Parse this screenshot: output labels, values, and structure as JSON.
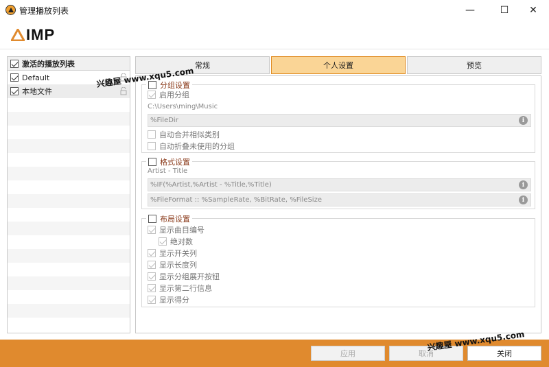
{
  "window": {
    "title": "管理播放列表",
    "min": "—",
    "max": "☐",
    "close": "✕"
  },
  "logo": {
    "text": "IMP"
  },
  "left_panel": {
    "header": "激活的播放列表",
    "items": [
      {
        "label": "Default"
      },
      {
        "label": "本地文件"
      }
    ]
  },
  "tabs": [
    {
      "label": "常规"
    },
    {
      "label": "个人设置"
    },
    {
      "label": "预览"
    }
  ],
  "grouping": {
    "title": "分组设置",
    "enable_label": "启用分组",
    "path_hint": "C:\\Users\\ming\\Music",
    "template": "%FileDir",
    "auto_merge_label": "自动合并相似类别",
    "auto_collapse_label": "自动折叠未使用的分组"
  },
  "format": {
    "title": "格式设置",
    "hint": "Artist - Title",
    "line1": "%IF(%Artist,%Artist - %Title,%Title)",
    "line2": "%FileFormat :: %SampleRate, %BitRate, %FileSize"
  },
  "layout": {
    "title": "布局设置",
    "options": [
      {
        "label": "显示曲目编号"
      },
      {
        "label": "绝对数"
      },
      {
        "label": "显示开关列"
      },
      {
        "label": "显示长度列"
      },
      {
        "label": "显示分组展开按钮"
      },
      {
        "label": "显示第二行信息"
      },
      {
        "label": "显示得分"
      }
    ]
  },
  "footer": {
    "apply": "应用",
    "cancel": "取消",
    "close": "关闭"
  },
  "watermarks": [
    "兴趣屋 www.xqu5.com",
    "兴趣屋 www.xqu5.com"
  ],
  "colors": {
    "accent": "#e08a2e",
    "tab_active": "#fad596",
    "group_title": "#8a3a1a"
  }
}
